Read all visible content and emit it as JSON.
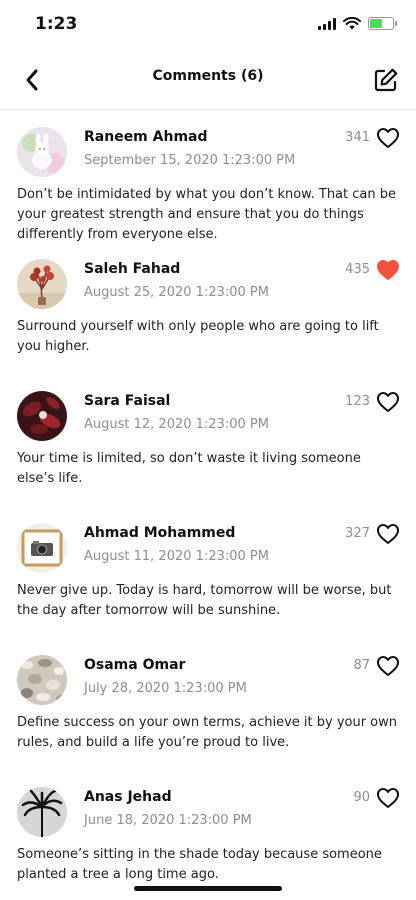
{
  "status": {
    "time": "1:23"
  },
  "nav": {
    "title": "Comments (6)",
    "back_icon": "chevron-left-icon",
    "edit_icon": "compose-icon"
  },
  "colors": {
    "liked": "#f0533e",
    "muted": "#8e8e8e"
  },
  "comments": [
    {
      "author": "Raneem Ahmad",
      "date": "September 15, 2020 1:23:00 PM",
      "likes": "341",
      "liked": false,
      "text": "Don’t be intimidated by what you don’t know. That can be your greatest strength and ensure that you do things differently from everyone else."
    },
    {
      "author": "Saleh Fahad",
      "date": "August 25, 2020 1:23:00 PM",
      "likes": "435",
      "liked": true,
      "text": "Surround yourself with only people who are going to lift you higher."
    },
    {
      "author": "Sara Faisal",
      "date": "August 12, 2020 1:23:00 PM",
      "likes": "123",
      "liked": false,
      "text": "Your time is limited, so don’t waste it living someone else’s life."
    },
    {
      "author": "Ahmad Mohammed",
      "date": "August 11, 2020 1:23:00 PM",
      "likes": "327",
      "liked": false,
      "text": "Never give up. Today is hard, tomorrow will be worse, but the day after tomorrow will be sunshine."
    },
    {
      "author": "Osama Omar",
      "date": "July 28, 2020 1:23:00 PM",
      "likes": "87",
      "liked": false,
      "text": "Define success on your own terms, achieve it by your own rules, and build a life you’re proud to live."
    },
    {
      "author": "Anas Jehad",
      "date": "June 18, 2020 1:23:00 PM",
      "likes": "90",
      "liked": false,
      "text": "Someone’s sitting in the shade today because someone planted a tree a long time ago."
    }
  ]
}
